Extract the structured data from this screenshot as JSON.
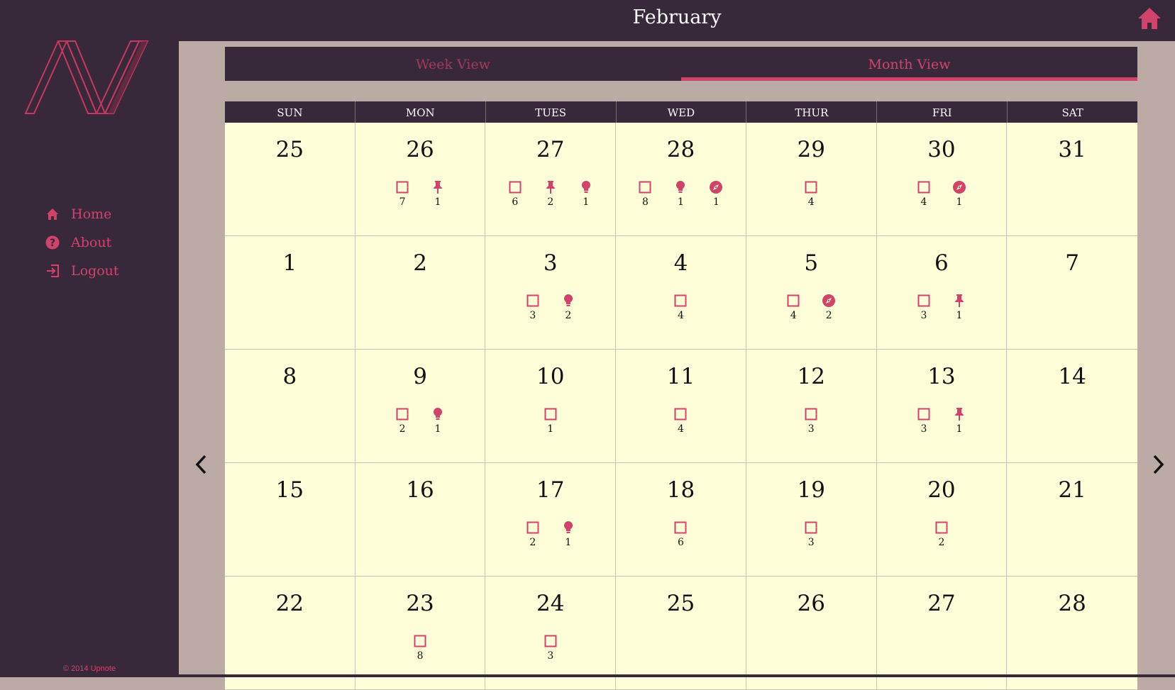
{
  "app": {
    "month_title": "February",
    "copyright": "© 2014 Upnote",
    "colors": {
      "dark": "#37293a",
      "accent": "#d2436b",
      "page_bg": "#bcaaa4",
      "cell_bg": "#fefed8"
    }
  },
  "sidebar": {
    "nav": [
      {
        "label": "Home",
        "icon": "home-icon"
      },
      {
        "label": "About",
        "icon": "question-circle-icon"
      },
      {
        "label": "Logout",
        "icon": "logout-icon"
      }
    ]
  },
  "tabs": [
    {
      "label": "Week View",
      "active": false
    },
    {
      "label": "Month View",
      "active": true
    }
  ],
  "calendar": {
    "weekdays": [
      "SUN",
      "MON",
      "TUES",
      "WED",
      "THUR",
      "FRI",
      "SAT"
    ],
    "counter_types": {
      "task": "checkbox-icon",
      "pin": "pin-icon",
      "idea": "lightbulb-icon",
      "explore": "compass-icon"
    },
    "days": [
      {
        "day": "25",
        "counters": []
      },
      {
        "day": "26",
        "counters": [
          {
            "type": "task",
            "count": "7"
          },
          {
            "type": "pin",
            "count": "1"
          }
        ]
      },
      {
        "day": "27",
        "counters": [
          {
            "type": "task",
            "count": "6"
          },
          {
            "type": "pin",
            "count": "2"
          },
          {
            "type": "idea",
            "count": "1"
          }
        ]
      },
      {
        "day": "28",
        "counters": [
          {
            "type": "task",
            "count": "8"
          },
          {
            "type": "idea",
            "count": "1"
          },
          {
            "type": "explore",
            "count": "1"
          }
        ]
      },
      {
        "day": "29",
        "counters": [
          {
            "type": "task",
            "count": "4"
          }
        ]
      },
      {
        "day": "30",
        "counters": [
          {
            "type": "task",
            "count": "4"
          },
          {
            "type": "explore",
            "count": "1"
          }
        ]
      },
      {
        "day": "31",
        "counters": []
      },
      {
        "day": "1",
        "counters": []
      },
      {
        "day": "2",
        "counters": []
      },
      {
        "day": "3",
        "counters": [
          {
            "type": "task",
            "count": "3"
          },
          {
            "type": "idea",
            "count": "2"
          }
        ]
      },
      {
        "day": "4",
        "counters": [
          {
            "type": "task",
            "count": "4"
          }
        ]
      },
      {
        "day": "5",
        "counters": [
          {
            "type": "task",
            "count": "4"
          },
          {
            "type": "explore",
            "count": "2"
          }
        ]
      },
      {
        "day": "6",
        "counters": [
          {
            "type": "task",
            "count": "3"
          },
          {
            "type": "pin",
            "count": "1"
          }
        ]
      },
      {
        "day": "7",
        "counters": []
      },
      {
        "day": "8",
        "counters": []
      },
      {
        "day": "9",
        "counters": [
          {
            "type": "task",
            "count": "2"
          },
          {
            "type": "idea",
            "count": "1"
          }
        ]
      },
      {
        "day": "10",
        "counters": [
          {
            "type": "task",
            "count": "1"
          }
        ]
      },
      {
        "day": "11",
        "counters": [
          {
            "type": "task",
            "count": "4"
          }
        ]
      },
      {
        "day": "12",
        "counters": [
          {
            "type": "task",
            "count": "3"
          }
        ]
      },
      {
        "day": "13",
        "counters": [
          {
            "type": "task",
            "count": "3"
          },
          {
            "type": "pin",
            "count": "1"
          }
        ]
      },
      {
        "day": "14",
        "counters": []
      },
      {
        "day": "15",
        "counters": []
      },
      {
        "day": "16",
        "counters": []
      },
      {
        "day": "17",
        "counters": [
          {
            "type": "task",
            "count": "2"
          },
          {
            "type": "idea",
            "count": "1"
          }
        ]
      },
      {
        "day": "18",
        "counters": [
          {
            "type": "task",
            "count": "6"
          }
        ]
      },
      {
        "day": "19",
        "counters": [
          {
            "type": "task",
            "count": "3"
          }
        ]
      },
      {
        "day": "20",
        "counters": [
          {
            "type": "task",
            "count": "2"
          }
        ]
      },
      {
        "day": "21",
        "counters": []
      },
      {
        "day": "22",
        "counters": []
      },
      {
        "day": "23",
        "counters": [
          {
            "type": "task",
            "count": "8"
          }
        ]
      },
      {
        "day": "24",
        "counters": [
          {
            "type": "task",
            "count": "3"
          }
        ]
      },
      {
        "day": "25",
        "counters": []
      },
      {
        "day": "26",
        "counters": []
      },
      {
        "day": "27",
        "counters": []
      },
      {
        "day": "28",
        "counters": []
      }
    ]
  }
}
